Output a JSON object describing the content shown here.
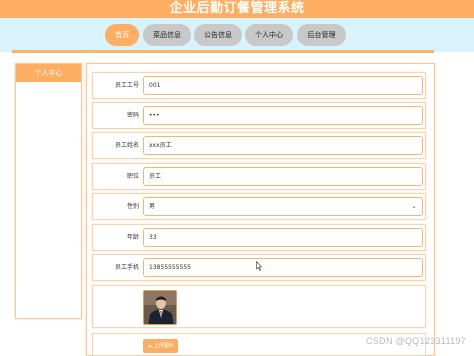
{
  "app": {
    "title": "企业后勤订餐管理系统"
  },
  "nav": {
    "items": [
      {
        "label": "首页",
        "active": true
      },
      {
        "label": "菜品信息",
        "active": false
      },
      {
        "label": "公告信息",
        "active": false
      },
      {
        "label": "个人中心",
        "active": false
      },
      {
        "label": "后台管理",
        "active": false
      }
    ]
  },
  "sidebar": {
    "title": "个人中心"
  },
  "form": {
    "fields": [
      {
        "label": "员工工号",
        "value": "001"
      },
      {
        "label": "密码",
        "value": "•••"
      },
      {
        "label": "员工姓名",
        "value": "xxx员工"
      },
      {
        "label": "职位",
        "value": "员工"
      },
      {
        "label": "性别",
        "value": "男"
      },
      {
        "label": "年龄",
        "value": "33"
      },
      {
        "label": "员工手机",
        "value": "13855555555"
      }
    ],
    "upload_label": "上传图片"
  },
  "watermark": "CSDN @QQ123311197",
  "colors": {
    "accent": "#fdae63",
    "nav_band": "#d8f3fb",
    "inactive": "#c8c8c8"
  },
  "icons": {
    "select": "chevron-down-icon",
    "upload": "upload-icon",
    "cursor": "mouse-cursor-icon"
  }
}
